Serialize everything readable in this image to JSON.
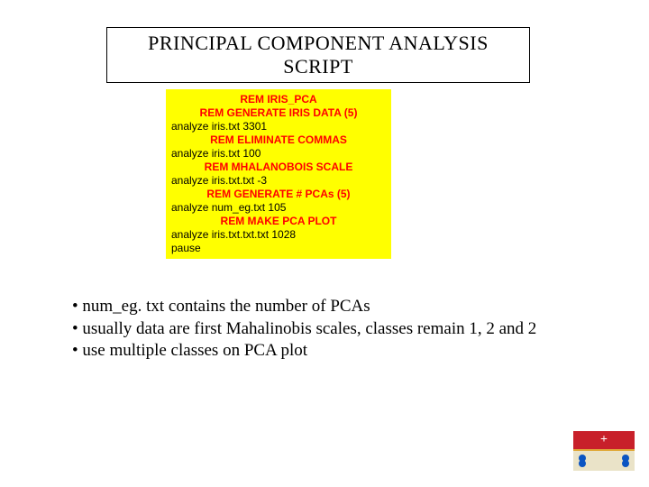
{
  "title": "PRINCIPAL COMPONENT ANALYSIS SCRIPT",
  "code": {
    "l1": "REM IRIS_PCA",
    "l2": "REM GENERATE IRIS DATA (5)",
    "l3": "analyze iris.txt 3301",
    "l4": "REM ELIMINATE COMMAS",
    "l5": "analyze iris.txt 100",
    "l6": "REM MHALANOBOIS SCALE",
    "l7": "analyze iris.txt.txt -3",
    "l8": "REM GENERATE # PCAs (5)",
    "l9": "analyze num_eg.txt 105",
    "l10": "REM MAKE PCA PLOT",
    "l11": "analyze iris.txt.txt.txt 1028",
    "l12": "pause"
  },
  "bullets": {
    "b1": "• num_eg. txt contains the number of PCAs",
    "b2": "• usually data are first Mahalinobis scales, classes remain 1, 2 and 2",
    "b3": "• use multiple classes on PCA plot"
  },
  "logo": {
    "plus": "+"
  }
}
